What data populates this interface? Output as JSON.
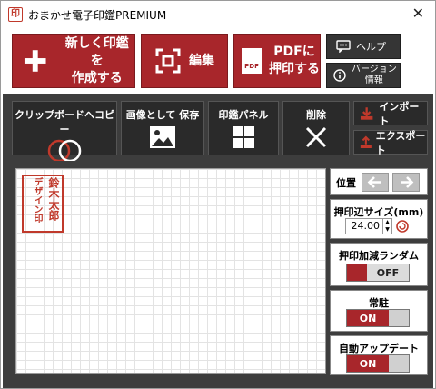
{
  "window": {
    "title": "おまかせ電子印鑑PREMIUM",
    "icon_glyph": "印",
    "close_glyph": "✕"
  },
  "top_buttons": {
    "create": {
      "line1": "新しく印鑑を",
      "line2": "作成する",
      "icon": "plus-icon"
    },
    "edit": {
      "label": "編集",
      "icon": "focus-frame-icon"
    },
    "pdf": {
      "line1": "PDFに",
      "line2": "押印する",
      "icon": "pdf-file-icon",
      "icon_text": "PDF"
    },
    "help": {
      "label": "ヘルプ",
      "icon": "chat-bubble-icon"
    },
    "version": {
      "line1": "バージョン",
      "line2": "情報",
      "icon": "info-icon"
    }
  },
  "toolbar": {
    "copy": "クリップボードへコピー",
    "save_image": "画像として 保存",
    "stamp_panel": "印鑑パネル",
    "delete": "削除",
    "import": "インポート",
    "export": "エクスポート"
  },
  "stamp_preview": {
    "col1": "鈴木太郎",
    "col2": "デザイン印",
    "color": "#c0392b"
  },
  "side": {
    "position_label": "位置",
    "size_label": "押印辺サイズ(mm)",
    "size_value": "24.00",
    "random_label": "押印加減ランダム",
    "random_state": "OFF",
    "resident_label": "常駐",
    "resident_state": "ON",
    "autoupdate_label": "自動アップデート",
    "autoupdate_state": "ON"
  },
  "colors": {
    "accent_red": "#a8262b",
    "toolbar_bg": "#3d3d3d",
    "button_dark": "#2a2a2a"
  }
}
